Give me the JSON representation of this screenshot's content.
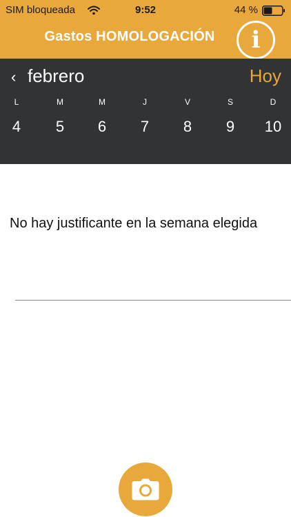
{
  "status_bar": {
    "carrier": "SIM bloqueada",
    "time": "9:52",
    "battery": "44 %"
  },
  "header": {
    "title": "Gastos HOMOLOGACIÓN",
    "info_icon": "i"
  },
  "calendar": {
    "month": "febrero",
    "today_label": "Hoy",
    "weekdays": [
      "L",
      "M",
      "M",
      "J",
      "V",
      "S",
      "D"
    ],
    "days": [
      "4",
      "5",
      "6",
      "7",
      "8",
      "9",
      "10"
    ]
  },
  "content": {
    "empty_message": "No hay justificante en la semana elegida"
  },
  "colors": {
    "accent": "#e9a83c",
    "calendar_bg": "#323335"
  }
}
